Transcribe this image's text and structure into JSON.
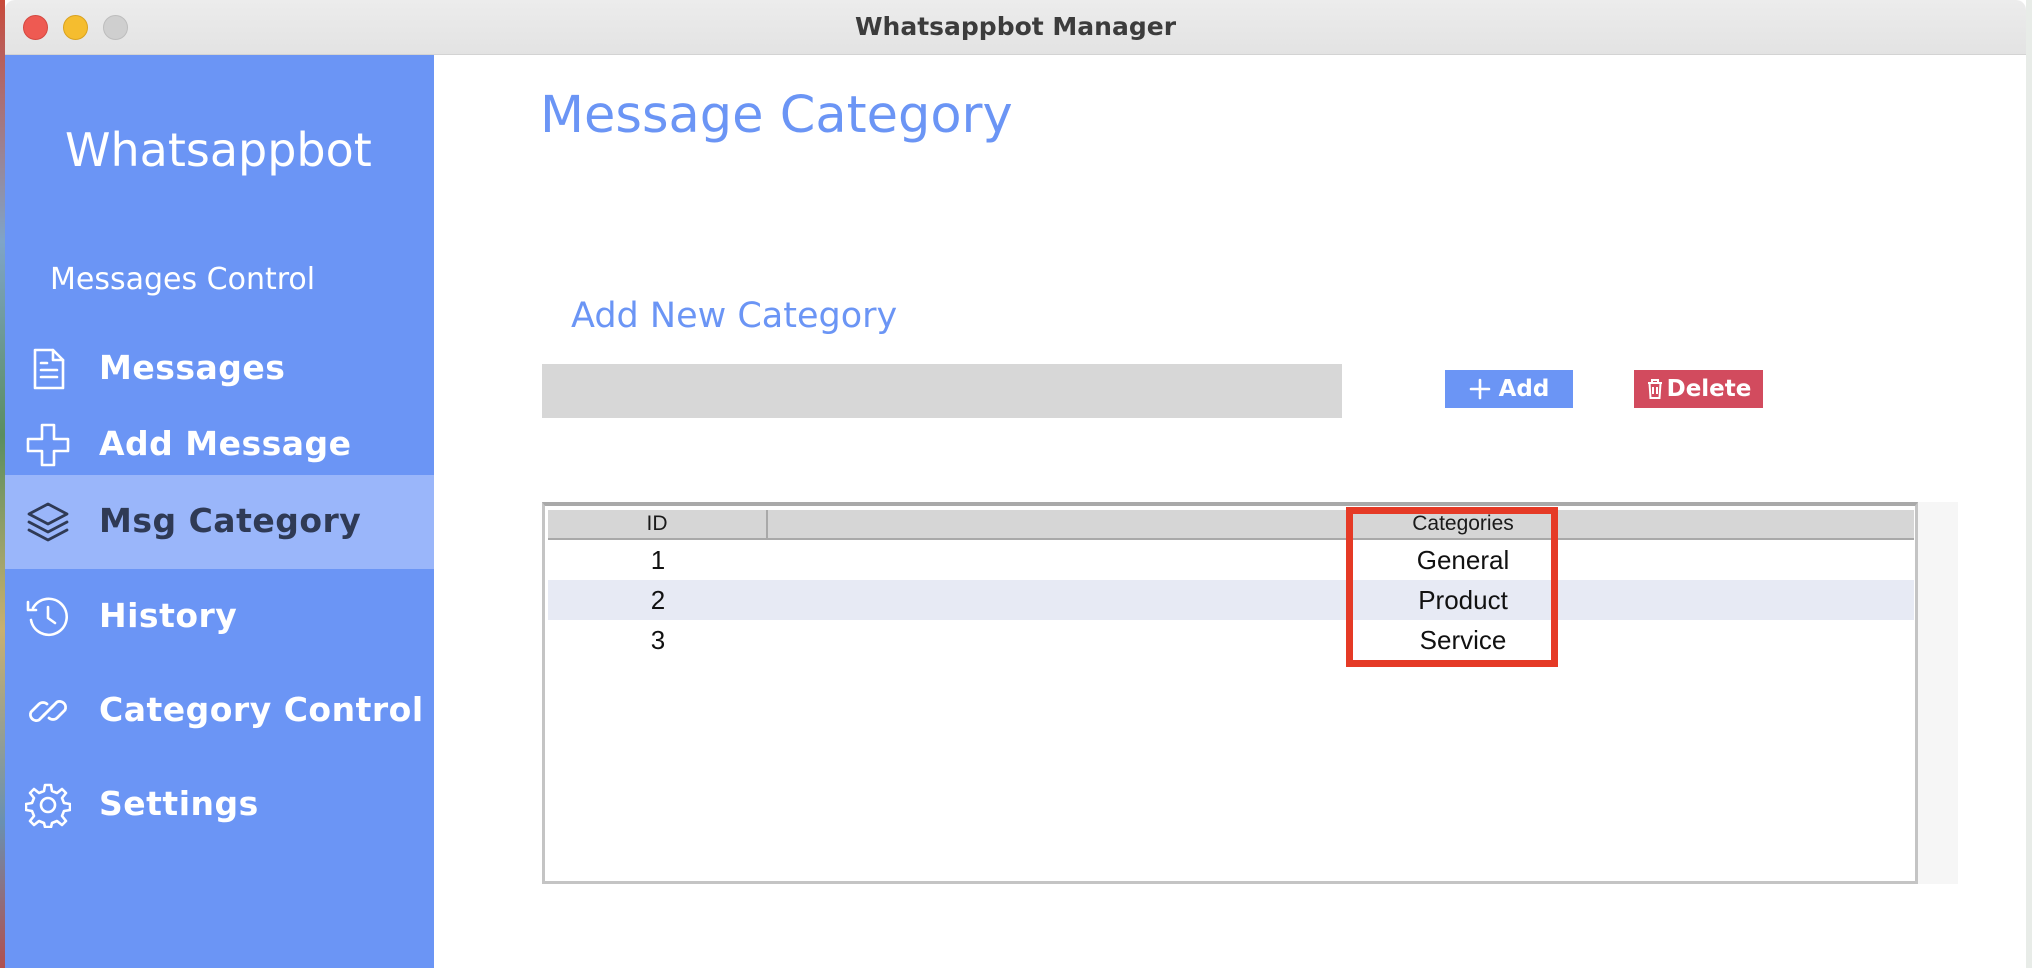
{
  "window": {
    "title": "Whatsappbot Manager"
  },
  "sidebar": {
    "brand": "Whatsappbot",
    "section_label": "Messages Control",
    "items": [
      {
        "label": "Messages",
        "icon": "document-icon",
        "active": false
      },
      {
        "label": "Add Message",
        "icon": "plus-icon",
        "active": false
      },
      {
        "label": "Msg Category",
        "icon": "layers-icon",
        "active": true
      },
      {
        "label": "History",
        "icon": "history-icon",
        "active": false
      },
      {
        "label": "Category Control",
        "icon": "link-icon",
        "active": false
      },
      {
        "label": "Settings",
        "icon": "gear-icon",
        "active": false
      }
    ]
  },
  "main": {
    "title": "Message Category",
    "add_section_title": "Add New Category",
    "input": {
      "value": "",
      "placeholder": ""
    },
    "add_button": "Add",
    "delete_button": "Delete",
    "table": {
      "columns": [
        "ID",
        "Categories"
      ],
      "rows": [
        {
          "id": "1",
          "category": "General"
        },
        {
          "id": "2",
          "category": "Product"
        },
        {
          "id": "3",
          "category": "Service"
        }
      ]
    }
  },
  "colors": {
    "accent": "#6b95f5",
    "active_item": "#9ab6fa",
    "delete": "#d24b5e",
    "highlight": "#e53a26"
  }
}
